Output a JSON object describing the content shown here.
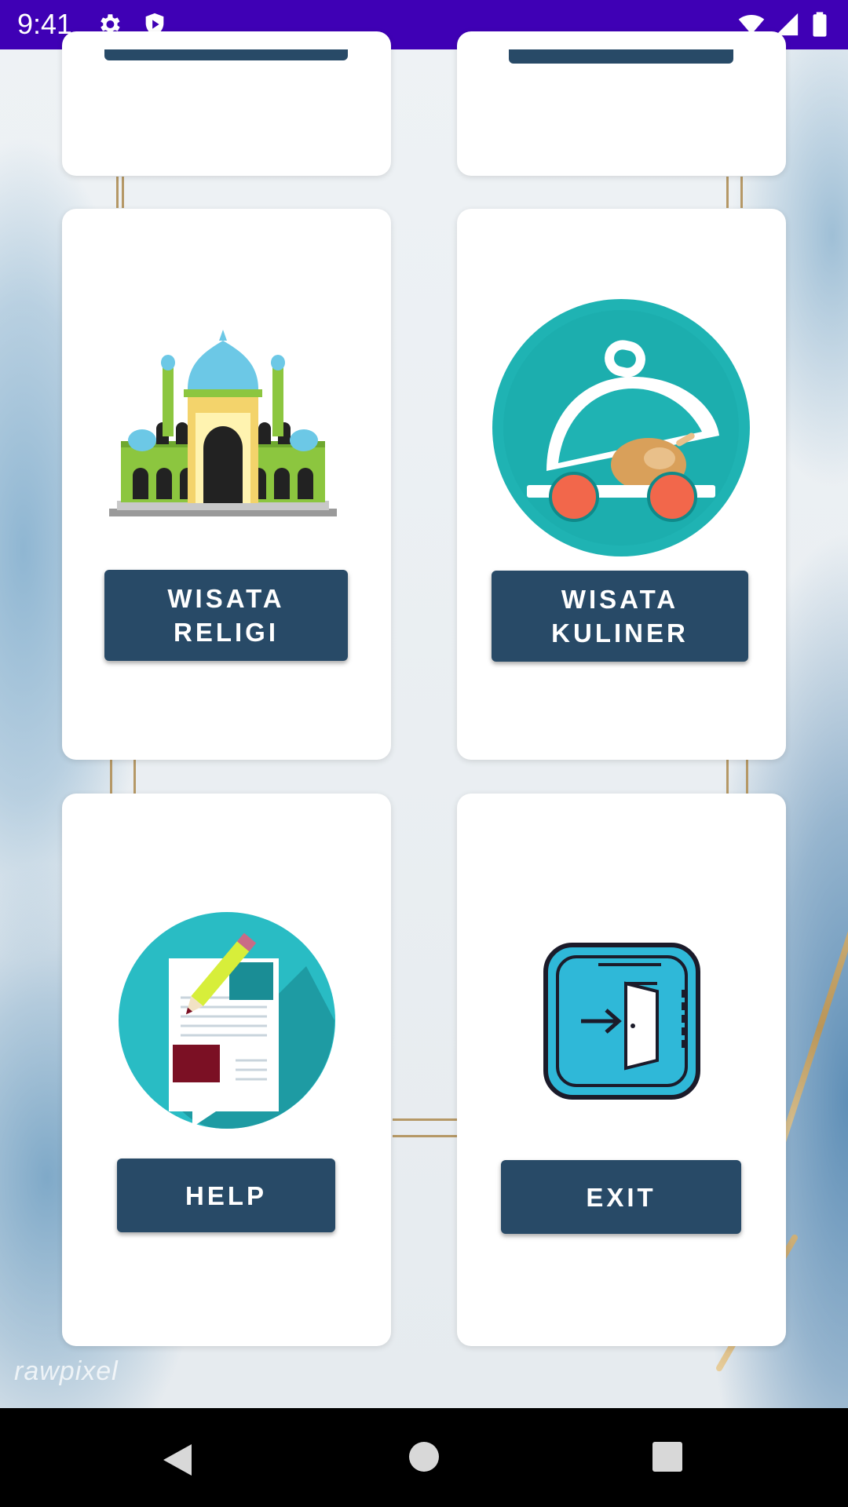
{
  "status_bar": {
    "time": "9:41",
    "icons": [
      "gear-icon",
      "shield-icon",
      "wifi-icon",
      "signal-icon",
      "battery-icon"
    ]
  },
  "menu": {
    "religi_label": "WISATA\nRELIGI",
    "kuliner_label": "WISATA\nKULINER",
    "help_label": "HELP",
    "exit_label": "EXIT"
  },
  "background": {
    "watermark": "rawpixel"
  },
  "colors": {
    "status_bar": "#3f00b5",
    "button": "#284a67",
    "card": "#ffffff",
    "teal": "#1fb3b3"
  },
  "nav_bar": {
    "icons": [
      "back-icon",
      "home-icon",
      "recents-icon"
    ]
  }
}
